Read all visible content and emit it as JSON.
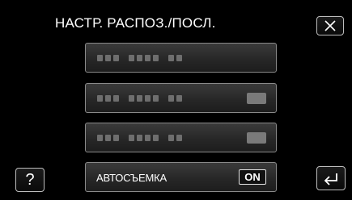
{
  "header": {
    "title": "НАСТР. РАСПОЗ./ПОСЛ."
  },
  "menu": {
    "items": [
      {
        "label": "",
        "obscured": true,
        "has_value": false
      },
      {
        "label": "",
        "obscured": true,
        "has_value": true
      },
      {
        "label": "",
        "obscured": true,
        "has_value": true
      },
      {
        "label": "АВТОСЪЕМКА",
        "value": "ON"
      }
    ]
  },
  "buttons": {
    "help_label": "?"
  },
  "icons": {
    "close": "close-icon",
    "back": "back-arrow-icon"
  }
}
